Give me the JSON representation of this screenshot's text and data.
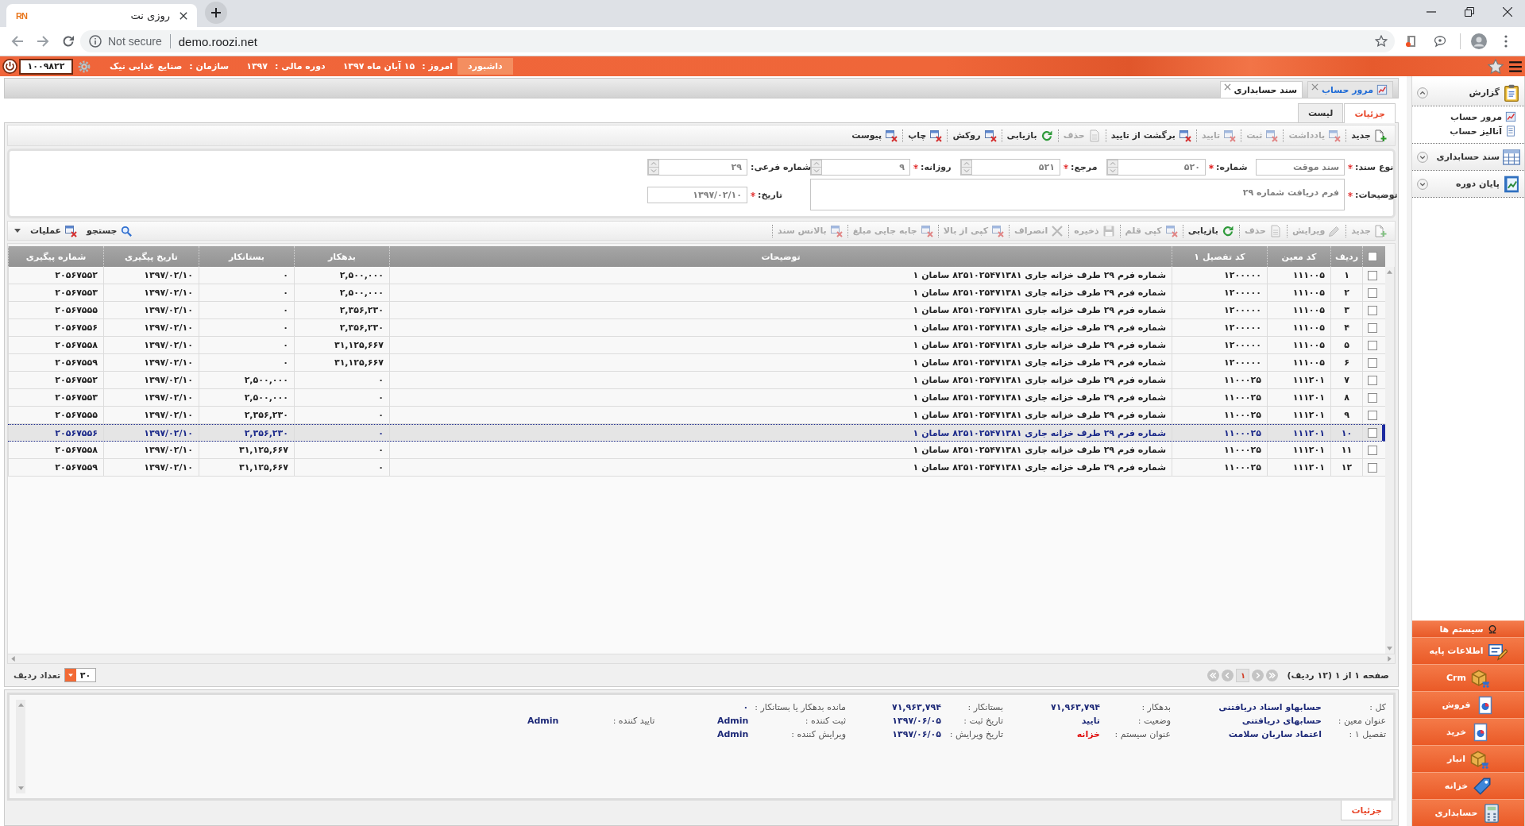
{
  "browser": {
    "favicon": "RN",
    "tab_title": "روزی نت",
    "security": "Not secure",
    "url": "demo.roozi.net"
  },
  "header": {
    "dashboard": "داشبورد",
    "items": [
      {
        "label": "امروز :",
        "value": "۱۵ آبان ماه ۱۳۹۷"
      },
      {
        "label": "دوره مالی :",
        "value": "۱۳۹۷"
      },
      {
        "label": "سازمان :",
        "value": "صنایع غذایی نیک"
      }
    ],
    "user_code": "۱۰۰۹۸۲۲"
  },
  "doc_tabs": [
    {
      "label": "مرور حساب",
      "selected": false
    },
    {
      "label": "سند حسابداری",
      "selected": true
    }
  ],
  "view_tabs": [
    {
      "label": "جزئیات",
      "selected": true
    },
    {
      "label": "لیست",
      "selected": false
    }
  ],
  "toolbar": [
    {
      "label": "جدید",
      "disabled": false
    },
    {
      "label": "یادداشت",
      "disabled": true
    },
    {
      "label": "ثبت",
      "disabled": true
    },
    {
      "label": "تایید",
      "disabled": true
    },
    {
      "label": "برگشت از تایید",
      "disabled": false
    },
    {
      "label": "حذف",
      "disabled": true
    },
    {
      "label": "بازیابی",
      "disabled": false
    },
    {
      "label": "روکش",
      "disabled": false
    },
    {
      "label": "چاپ",
      "disabled": false
    },
    {
      "label": "پیوست",
      "disabled": false
    }
  ],
  "form": {
    "fields": [
      {
        "kind": "text",
        "label": "نوع سند:",
        "required": true,
        "value": "سند موقت"
      },
      {
        "kind": "spin",
        "label": "شماره:",
        "required": true,
        "value": "۵۲۰"
      },
      {
        "kind": "spin",
        "label": "مرجع:",
        "required": true,
        "value": "۵۲۱"
      },
      {
        "kind": "spin",
        "label": "روزانه:",
        "required": true,
        "value": "۹"
      },
      {
        "kind": "spin",
        "label": "شماره فرعی:",
        "required": false,
        "value": "۲۹"
      },
      {
        "kind": "textarea",
        "label": "توضیحات:",
        "required": true,
        "value": "فرم دریافت شماره ۲۹"
      },
      {
        "kind": "text",
        "label": "تاریخ:",
        "required": true,
        "value": "۱۳۹۷/۰۲/۱۰"
      }
    ]
  },
  "grid_toolbar": {
    "buttons": [
      {
        "label": "جدید",
        "disabled": true
      },
      {
        "label": "ویرایش",
        "disabled": true
      },
      {
        "label": "حذف",
        "disabled": true
      },
      {
        "label": "بازیابی",
        "disabled": false
      },
      {
        "label": "کپی قلم",
        "disabled": true
      },
      {
        "label": "ذخیره",
        "disabled": true
      },
      {
        "label": "انصراف",
        "disabled": true
      },
      {
        "label": "کپی از بالا",
        "disabled": true
      },
      {
        "label": "جابه جایی مبلغ",
        "disabled": true
      },
      {
        "label": "بالانس سند",
        "disabled": true
      }
    ],
    "search": "جستجو",
    "actions": "عملیات"
  },
  "table": {
    "all_checked": false,
    "columns": [
      "ردیف",
      "کد معین",
      "کد تفصیل ۱",
      "توضیحات",
      "بدهکار",
      "بستانکار",
      "تاریخ پیگیری",
      "شماره پیگیری"
    ],
    "rows": [
      {
        "checked": false,
        "selected": false,
        "cells": [
          "۱",
          "۱۱۱۰۰۵",
          "۱۲۰۰۰۰۰",
          "شماره فرم ۲۹ طرف خزانه جاری ۸۲۵۱۰۲۵۴۷۱۳۸۱ سامان ۱",
          "۲,۵۰۰,۰۰۰",
          "۰",
          "۱۳۹۷/۰۲/۱۰",
          "۲۰۵۶۷۵۵۲"
        ]
      },
      {
        "checked": false,
        "selected": false,
        "cells": [
          "۲",
          "۱۱۱۰۰۵",
          "۱۲۰۰۰۰۰",
          "شماره فرم ۲۹ طرف خزانه جاری ۸۲۵۱۰۲۵۴۷۱۳۸۱ سامان ۱",
          "۲,۵۰۰,۰۰۰",
          "۰",
          "۱۳۹۷/۰۲/۱۰",
          "۲۰۵۶۷۵۵۳"
        ]
      },
      {
        "checked": false,
        "selected": false,
        "cells": [
          "۳",
          "۱۱۱۰۰۵",
          "۱۲۰۰۰۰۰",
          "شماره فرم ۲۹ طرف خزانه جاری ۸۲۵۱۰۲۵۴۷۱۳۸۱ سامان ۱",
          "۲,۳۵۶,۲۳۰",
          "۰",
          "۱۳۹۷/۰۲/۱۰",
          "۲۰۵۶۷۵۵۵"
        ]
      },
      {
        "checked": false,
        "selected": false,
        "cells": [
          "۴",
          "۱۱۱۰۰۵",
          "۱۲۰۰۰۰۰",
          "شماره فرم ۲۹ طرف خزانه جاری ۸۲۵۱۰۲۵۴۷۱۳۸۱ سامان ۱",
          "۲,۳۵۶,۲۳۰",
          "۰",
          "۱۳۹۷/۰۲/۱۰",
          "۲۰۵۶۷۵۵۶"
        ]
      },
      {
        "checked": false,
        "selected": false,
        "cells": [
          "۵",
          "۱۱۱۰۰۵",
          "۱۲۰۰۰۰۰",
          "شماره فرم ۲۹ طرف خزانه جاری ۸۲۵۱۰۲۵۴۷۱۳۸۱ سامان ۱",
          "۳۱,۱۲۵,۶۶۷",
          "۰",
          "۱۳۹۷/۰۲/۱۰",
          "۲۰۵۶۷۵۵۸"
        ]
      },
      {
        "checked": false,
        "selected": false,
        "cells": [
          "۶",
          "۱۱۱۰۰۵",
          "۱۲۰۰۰۰۰",
          "شماره فرم ۲۹ طرف خزانه جاری ۸۲۵۱۰۲۵۴۷۱۳۸۱ سامان ۱",
          "۳۱,۱۲۵,۶۶۷",
          "۰",
          "۱۳۹۷/۰۲/۱۰",
          "۲۰۵۶۷۵۵۹"
        ]
      },
      {
        "checked": false,
        "selected": false,
        "cells": [
          "۷",
          "۱۱۱۲۰۱",
          "۱۱۰۰۰۲۵",
          "شماره فرم ۲۹ طرف خزانه جاری ۸۲۵۱۰۲۵۴۷۱۳۸۱ سامان ۱",
          "۰",
          "۲,۵۰۰,۰۰۰",
          "۱۳۹۷/۰۲/۱۰",
          "۲۰۵۶۷۵۵۲"
        ]
      },
      {
        "checked": false,
        "selected": false,
        "cells": [
          "۸",
          "۱۱۱۲۰۱",
          "۱۱۰۰۰۲۵",
          "شماره فرم ۲۹ طرف خزانه جاری ۸۲۵۱۰۲۵۴۷۱۳۸۱ سامان ۱",
          "۰",
          "۲,۵۰۰,۰۰۰",
          "۱۳۹۷/۰۲/۱۰",
          "۲۰۵۶۷۵۵۳"
        ]
      },
      {
        "checked": false,
        "selected": false,
        "cells": [
          "۹",
          "۱۱۱۲۰۱",
          "۱۱۰۰۰۲۵",
          "شماره فرم ۲۹ طرف خزانه جاری ۸۲۵۱۰۲۵۴۷۱۳۸۱ سامان ۱",
          "۰",
          "۲,۳۵۶,۲۳۰",
          "۱۳۹۷/۰۲/۱۰",
          "۲۰۵۶۷۵۵۵"
        ]
      },
      {
        "checked": false,
        "selected": true,
        "cells": [
          "۱۰",
          "۱۱۱۲۰۱",
          "۱۱۰۰۰۲۵",
          "شماره فرم ۲۹ طرف خزانه جاری ۸۲۵۱۰۲۵۴۷۱۳۸۱ سامان ۱",
          "۰",
          "۲,۳۵۶,۲۳۰",
          "۱۳۹۷/۰۲/۱۰",
          "۲۰۵۶۷۵۵۶"
        ]
      },
      {
        "checked": false,
        "selected": false,
        "cells": [
          "۱۱",
          "۱۱۱۲۰۱",
          "۱۱۰۰۰۲۵",
          "شماره فرم ۲۹ طرف خزانه جاری ۸۲۵۱۰۲۵۴۷۱۳۸۱ سامان ۱",
          "۰",
          "۳۱,۱۲۵,۶۶۷",
          "۱۳۹۷/۰۲/۱۰",
          "۲۰۵۶۷۵۵۸"
        ]
      },
      {
        "checked": false,
        "selected": false,
        "cells": [
          "۱۲",
          "۱۱۱۲۰۱",
          "۱۱۰۰۰۲۵",
          "شماره فرم ۲۹ طرف خزانه جاری ۸۲۵۱۰۲۵۴۷۱۳۸۱ سامان ۱",
          "۰",
          "۳۱,۱۲۵,۶۶۷",
          "۱۳۹۷/۰۲/۱۰",
          "۲۰۵۶۷۵۵۹"
        ]
      }
    ]
  },
  "pager": {
    "summary": "صفحه ۱ از ۱ (۱۲ ردیف)",
    "page": "۱",
    "page_size": "۳۰",
    "page_size_label": "تعداد ردیف"
  },
  "details": {
    "rows": [
      [
        {
          "label": "کل :",
          "value": "حسابهاو اسناد دریافتنی",
          "highlight": false
        },
        {
          "label": "بدهکار :",
          "value": "۷۱,۹۶۳,۷۹۴",
          "highlight": false
        },
        {
          "label": "بستانکار :",
          "value": "۷۱,۹۶۳,۷۹۴",
          "highlight": false
        },
        {
          "label": "مانده بدهکار یا بستانکار :",
          "value": "۰",
          "highlight": false
        }
      ],
      [
        {
          "label": "عنوان معین :",
          "value": "حسابهای دریافتنی",
          "highlight": false
        },
        {
          "label": "وضعیت :",
          "value": "تایید",
          "highlight": false
        },
        {
          "label": "تاریخ ثبت :",
          "value": "۱۳۹۷/۰۶/۰۵",
          "highlight": false
        },
        {
          "label": "ثبت کننده :",
          "value": "Admin",
          "highlight": false
        },
        {
          "label": "تایید کننده :",
          "value": "Admin",
          "highlight": false
        }
      ],
      [
        {
          "label": "تفصیل ۱ :",
          "value": "اعتماد ساربان سلامت",
          "highlight": false
        },
        {
          "label": "عنوان سیستم :",
          "value": "خزانه",
          "highlight": true
        },
        {
          "label": "تاریخ ویرایش :",
          "value": "۱۳۹۷/۰۶/۰۵",
          "highlight": false
        },
        {
          "label": "ویرایش کننده :",
          "value": "Admin",
          "highlight": false
        }
      ]
    ]
  },
  "bottom_tabs": [
    {
      "label": "جزئیات",
      "selected": true
    }
  ],
  "sidebar": {
    "groups": [
      {
        "title": "گزارش",
        "expanded": true,
        "items": [
          {
            "label": "مرور حساب"
          },
          {
            "label": "آنالیز حساب"
          }
        ]
      },
      {
        "title": "سند حسابداری",
        "expanded": false
      },
      {
        "title": "پایان دوره",
        "expanded": false
      }
    ],
    "systems_title": "سیستم ها",
    "systems": [
      "اطلاعات پایه",
      "Crm",
      "فروش",
      "خرید",
      "انبار",
      "خزانه",
      "حسابداری"
    ]
  }
}
